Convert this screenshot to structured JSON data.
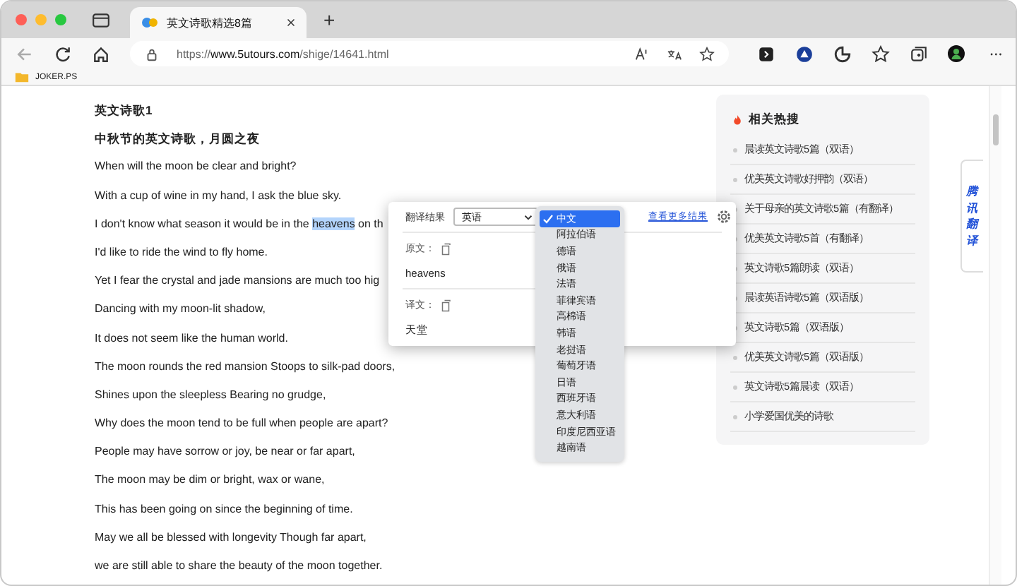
{
  "browser": {
    "tab_title": "英文诗歌精选8篇",
    "new_tab": "+",
    "url_prefix": "https://",
    "url_domain": "www.5utours.com",
    "url_path": "/shige/14641.html",
    "bookmark": "JOKER.PS"
  },
  "article": {
    "lines": [
      {
        "kind": "heading",
        "text": "英文诗歌1"
      },
      {
        "kind": "heading",
        "text": "中秋节的英文诗歌，月圆之夜"
      },
      {
        "kind": "line",
        "text": "When will the moon be clear and bright?"
      },
      {
        "kind": "line",
        "text": "With a cup of wine in my hand, I ask the blue sky."
      },
      {
        "kind": "highlight",
        "before": "I don't know what season it would be in the ",
        "selected_text": "heavens",
        "after": " on th"
      },
      {
        "kind": "line",
        "text": "I'd like to ride the wind to fly home."
      },
      {
        "kind": "line",
        "text": "Yet I fear the crystal and jade mansions are much too hig"
      },
      {
        "kind": "line",
        "text": "Dancing with my moon-lit shadow,"
      },
      {
        "kind": "line",
        "text": "It does not seem like the human world."
      },
      {
        "kind": "line",
        "text": "The moon rounds the red mansion Stoops to silk-pad doors,"
      },
      {
        "kind": "line",
        "text": "Shines upon the sleepless Bearing no grudge,"
      },
      {
        "kind": "line",
        "text": "Why does the moon tend to be full when people are apart?"
      },
      {
        "kind": "line",
        "text": "People may have sorrow or joy, be near or far apart,"
      },
      {
        "kind": "line",
        "text": "The moon may be dim or bright, wax or wane,"
      },
      {
        "kind": "line",
        "text": "This has been going on since the beginning of time."
      },
      {
        "kind": "line",
        "text": "May we all be blessed with longevity Though far apart,"
      },
      {
        "kind": "line",
        "text": "we are still able to share the beauty of the moon together."
      }
    ]
  },
  "sidebar": {
    "title": "相关热搜",
    "items": [
      "晨读英文诗歌5篇（双语）",
      "优美英文诗歌好押韵（双语）",
      "关于母亲的英文诗歌5篇（有翻译）",
      "优美英文诗歌5首（有翻译）",
      "英文诗歌5篇朗读（双语）",
      "晨读英语诗歌5篇（双语版）",
      "英文诗歌5篇（双语版）",
      "优美英文诗歌5篇（双语版）",
      "英文诗歌5篇晨读（双语）",
      "小学爱国优美的诗歌"
    ]
  },
  "side_tab": "腾讯翻译",
  "translator": {
    "label": "翻译结果",
    "source_language": "英语",
    "more_link": "查看更多结果",
    "source_label": "原文：",
    "source_text": "heavens",
    "target_label": "译文：",
    "target_text": "天堂",
    "languages": [
      {
        "name": "中文",
        "selected": true
      },
      {
        "name": "阿拉伯语",
        "selected": false
      },
      {
        "name": "德语",
        "selected": false
      },
      {
        "name": "俄语",
        "selected": false
      },
      {
        "name": "法语",
        "selected": false
      },
      {
        "name": "菲律宾语",
        "selected": false
      },
      {
        "name": "高棉语",
        "selected": false
      },
      {
        "name": "韩语",
        "selected": false
      },
      {
        "name": "老挝语",
        "selected": false
      },
      {
        "name": "葡萄牙语",
        "selected": false
      },
      {
        "name": "日语",
        "selected": false
      },
      {
        "name": "西班牙语",
        "selected": false
      },
      {
        "name": "意大利语",
        "selected": false
      },
      {
        "name": "印度尼西亚语",
        "selected": false
      },
      {
        "name": "越南语",
        "selected": false
      }
    ]
  }
}
